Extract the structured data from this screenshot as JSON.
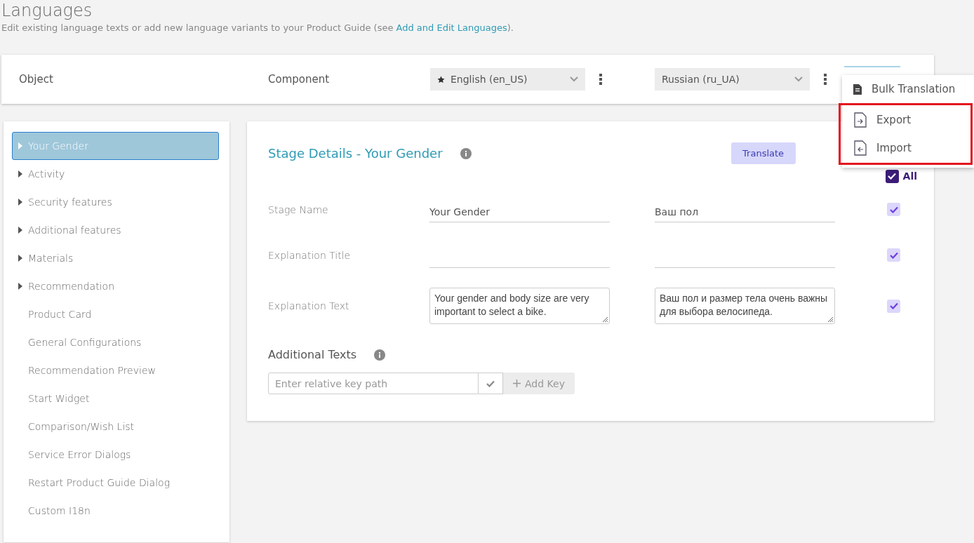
{
  "page": {
    "title": "Languages",
    "description_before": "Edit existing language texts or add new language variants to your Product Guide (see ",
    "description_link": "Add and Edit Languages",
    "description_after": ")."
  },
  "header": {
    "object_label": "Object",
    "component_label": "Component",
    "source_language": {
      "value": "English (en_US)",
      "default": true
    },
    "target_language": {
      "value": "Russian (ru_UA)",
      "default": false
    }
  },
  "menu": {
    "items": [
      {
        "label": "Bulk Translation",
        "kind": "bulk"
      },
      {
        "label": "Export",
        "kind": "export"
      },
      {
        "label": "Import",
        "kind": "import"
      }
    ]
  },
  "sidebar": {
    "items": [
      {
        "label": "Your Gender",
        "expandable": true,
        "selected": true
      },
      {
        "label": "Activity",
        "expandable": true,
        "selected": false
      },
      {
        "label": "Security features",
        "expandable": true,
        "selected": false
      },
      {
        "label": "Additional features",
        "expandable": true,
        "selected": false
      },
      {
        "label": "Materials",
        "expandable": true,
        "selected": false
      },
      {
        "label": "Recommendation",
        "expandable": true,
        "selected": false
      },
      {
        "label": "Product Card",
        "expandable": false,
        "selected": false
      },
      {
        "label": "General Configurations",
        "expandable": false,
        "selected": false
      },
      {
        "label": "Recommendation Preview",
        "expandable": false,
        "selected": false
      },
      {
        "label": "Start Widget",
        "expandable": false,
        "selected": false
      },
      {
        "label": "Comparison/Wish List",
        "expandable": false,
        "selected": false
      },
      {
        "label": "Service Error Dialogs",
        "expandable": false,
        "selected": false
      },
      {
        "label": "Restart Product Guide Dialog",
        "expandable": false,
        "selected": false
      },
      {
        "label": "Custom I18n",
        "expandable": false,
        "selected": false
      }
    ]
  },
  "details": {
    "title": "Stage Details - Your Gender",
    "translate_button": "Translate",
    "all": {
      "label": "All",
      "checked": true
    },
    "fields": [
      {
        "label": "Stage Name",
        "kind": "line",
        "source": "Your Gender",
        "target": "Ваш пол",
        "checked": true
      },
      {
        "label": "Explanation Title",
        "kind": "line",
        "checked": true
      },
      {
        "label": "Explanation Text",
        "kind": "area",
        "source": "Your gender and body size are very important to select a bike.",
        "target": "Ваш пол и размер тела очень важны для выбора велосипеда.",
        "checked": true
      }
    ],
    "additional_title": "Additional Texts",
    "key_placeholder": "Enter relative key path",
    "add_key_button": "Add Key"
  }
}
